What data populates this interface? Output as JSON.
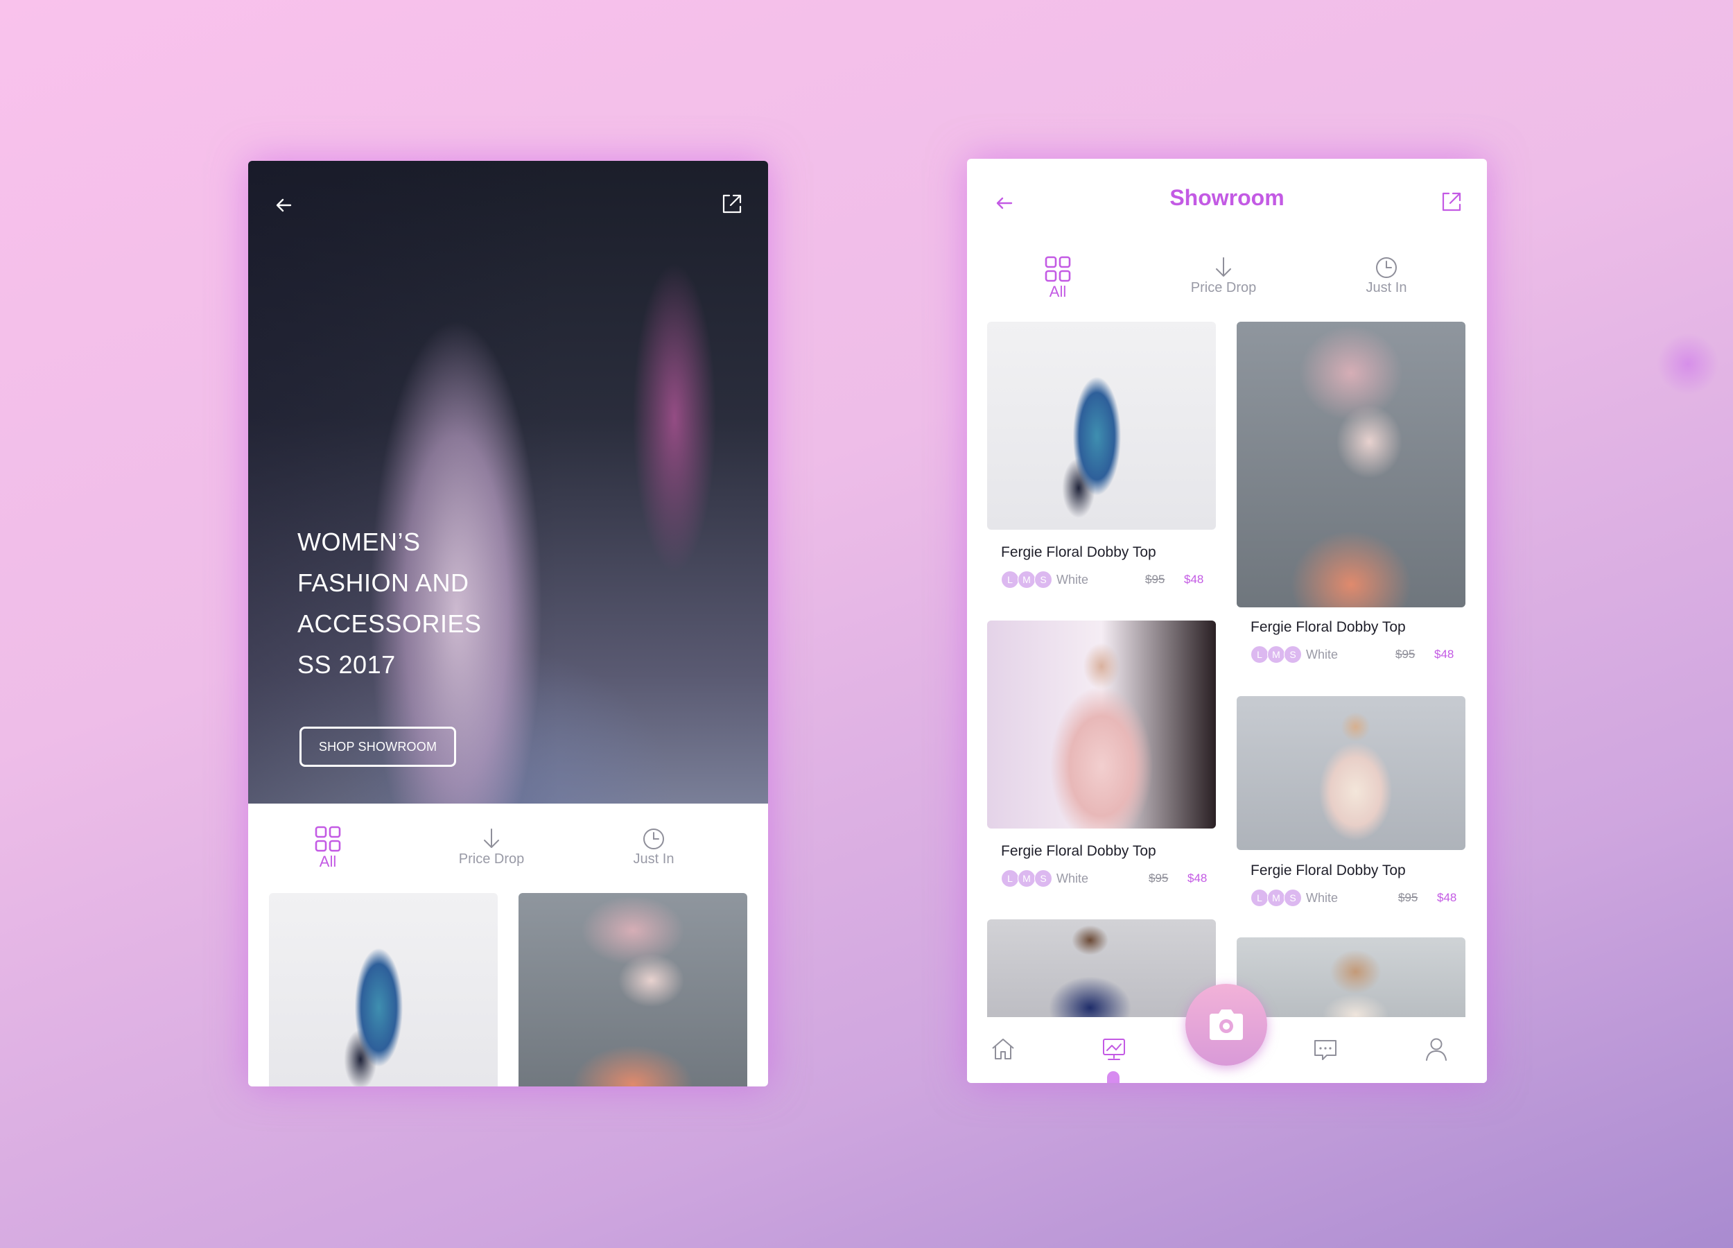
{
  "left_screen": {
    "hero": {
      "title_lines": [
        "WOMEN’S",
        "FASHION AND",
        "ACCESSORIES",
        "SS 2017"
      ],
      "cta_label": "SHOP SHOWROOM"
    },
    "tabs": [
      {
        "label": "All",
        "active": true,
        "icon": "grid-icon"
      },
      {
        "label": "Price Drop",
        "active": false,
        "icon": "arrow-down-icon"
      },
      {
        "label": "Just In",
        "active": false,
        "icon": "clock-icon"
      }
    ]
  },
  "right_screen": {
    "title": "Showroom",
    "tabs": [
      {
        "label": "All",
        "active": true,
        "icon": "grid-icon"
      },
      {
        "label": "Price Drop",
        "active": false,
        "icon": "arrow-down-icon"
      },
      {
        "label": "Just In",
        "active": false,
        "icon": "clock-icon"
      }
    ],
    "products": [
      {
        "name": "Fergie Floral Dobby Top",
        "sizes": [
          "L",
          "M",
          "S"
        ],
        "color": "White",
        "old_price": "$95",
        "price": "$48"
      },
      {
        "name": "Fergie Floral Dobby Top",
        "sizes": [
          "L",
          "M",
          "S"
        ],
        "color": "White",
        "old_price": "$95",
        "price": "$48"
      },
      {
        "name": "Fergie Floral Dobby Top",
        "sizes": [
          "L",
          "M",
          "S"
        ],
        "color": "White",
        "old_price": "$95",
        "price": "$48"
      },
      {
        "name": "Fergie Floral Dobby Top",
        "sizes": [
          "L",
          "M",
          "S"
        ],
        "color": "White",
        "old_price": "$95",
        "price": "$48"
      }
    ],
    "bottom_nav": [
      "home-icon",
      "showroom-icon",
      "camera-icon",
      "chat-icon",
      "profile-icon"
    ]
  },
  "colors": {
    "accent": "#c35ae4",
    "inactive_text": "#999aa6",
    "size_dot": "#dcb8f0"
  }
}
